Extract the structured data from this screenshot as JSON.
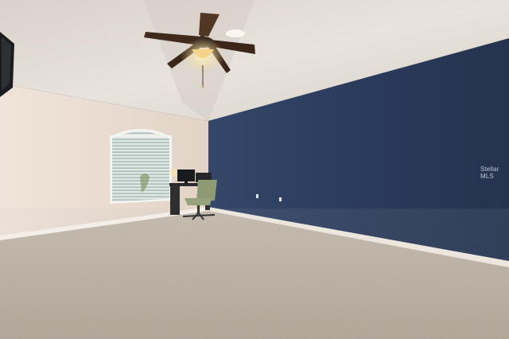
{
  "photo": {
    "kind": "empty bedroom interior",
    "accent_wall_color": "#2b3a59",
    "side_wall_color": "#e6d8cc",
    "ceiling_color": "#e4ddd6",
    "carpet_color": "#bdb3a6",
    "baseboard_color": "#ece6df"
  },
  "watermark": {
    "text": "Stellar MLS"
  },
  "objects": [
    "ceiling-fan-icon",
    "arched-window",
    "desk",
    "computer-monitor",
    "office-chair",
    "wall-mounted-tv",
    "electrical-outlet"
  ]
}
